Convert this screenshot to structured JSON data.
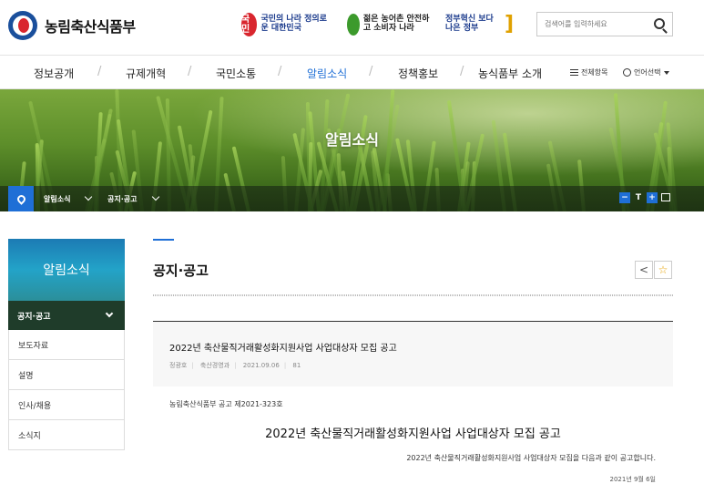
{
  "header": {
    "logo_text": "농림축산식품부",
    "slogan1_badge": "국민",
    "slogan1_text": "국민의 나라 정의로운 대한민국",
    "slogan2_text": "젊은 농어촌 안전하고 소비자 나라",
    "slogan3_text": "정부혁신 보다 나은 정부",
    "search_placeholder": "검색어를 입력하세요"
  },
  "nav": {
    "items": [
      "정보공개",
      "규제개혁",
      "국민소통",
      "알림소식",
      "정책홍보",
      "농식품부 소개"
    ],
    "active_index": 3,
    "all_menu": "전체항목",
    "language": "언어선택"
  },
  "banner": {
    "title": "알림소식",
    "breadcrumb": [
      "알림소식",
      "공지·공고"
    ],
    "tools": [
      "−",
      "T",
      "+"
    ]
  },
  "sidebar": {
    "title": "알림소식",
    "active": "공지·공고",
    "items": [
      "보도자료",
      "설명",
      "인사/채용",
      "소식지"
    ]
  },
  "main": {
    "page_title": "공지·공고",
    "post_title": "2022년 축산물직거래활성화지원사업 사업대상자 모집 공고",
    "author": "정광호",
    "department": "축산경영과",
    "date": "2021.09.06",
    "views": "81",
    "notice_no": "농림축산식품부 공고 제2021-323호",
    "body_title": "2022년 축산물직거래활성화지원사업 사업대상자 모집 공고",
    "body_line": "2022년 축산물직거래활성화지원사업 사업대상자 모집을 다음과 같이 공고합니다.",
    "body_date": "2021년 9월 6일"
  },
  "colors": {
    "accent": "#1f6fd6",
    "sidebar_active": "#1f3c2a",
    "star": "#e6a100"
  }
}
